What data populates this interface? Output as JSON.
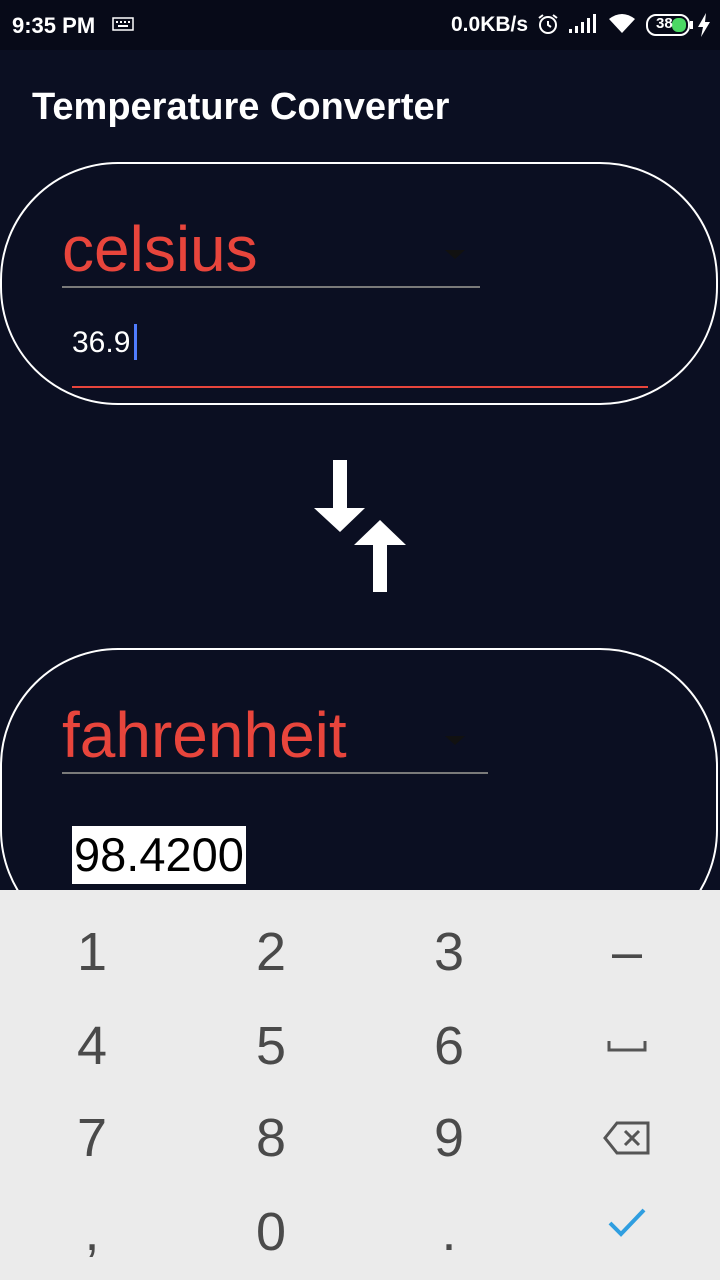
{
  "status_bar": {
    "time": "9:35 PM",
    "net_speed": "0.0KB/s",
    "battery_level": "38",
    "icons": [
      "keyboard-icon",
      "alarm-icon",
      "signal-icon",
      "wifi-icon",
      "battery-icon",
      "charging-icon"
    ]
  },
  "app": {
    "title": "Temperature Converter"
  },
  "from": {
    "unit": "celsius",
    "value": "36.9"
  },
  "swap": {
    "icon": "swap-arrows-icon"
  },
  "to": {
    "unit": "fahrenheit",
    "value": "98.4200"
  },
  "keyboard": {
    "rows": [
      [
        "1",
        "2",
        "3",
        "–"
      ],
      [
        "4",
        "5",
        "6",
        "space"
      ],
      [
        "7",
        "8",
        "9",
        "backspace"
      ],
      [
        ",",
        "0",
        ".",
        "done"
      ]
    ]
  },
  "colors": {
    "background": "#0b0f22",
    "accent": "#e8453c",
    "caret": "#4f7cff",
    "keyboard_bg": "#ebebeb",
    "done_check": "#2f9ee0"
  }
}
